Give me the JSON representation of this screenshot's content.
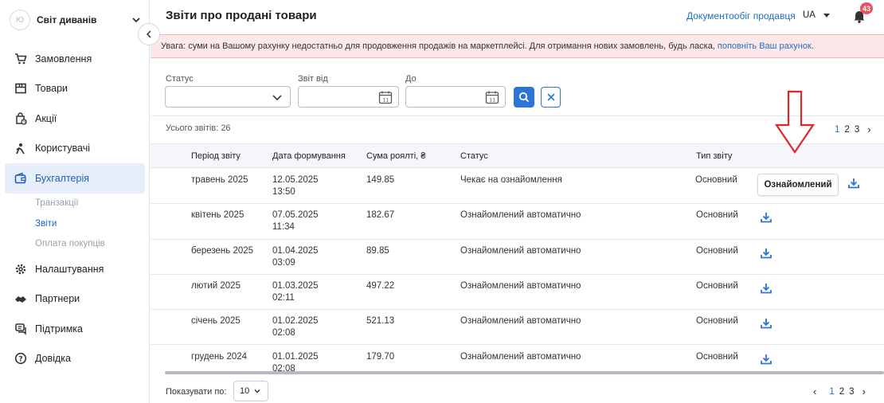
{
  "sidebar": {
    "shop_avatar": "Ю",
    "shop_name": "Світ диванів",
    "items": [
      {
        "label": "Замовлення",
        "icon": "cart-icon"
      },
      {
        "label": "Товари",
        "icon": "box-icon"
      },
      {
        "label": "Акції",
        "icon": "promo-bag-icon"
      },
      {
        "label": "Користувачі",
        "icon": "users-icon"
      },
      {
        "label": "Бухгалтерія",
        "icon": "wallet-icon",
        "active": true
      },
      {
        "label": "Налаштування",
        "icon": "gear-icon"
      },
      {
        "label": "Партнери",
        "icon": "handshake-icon"
      },
      {
        "label": "Підтримка",
        "icon": "support-chat-icon"
      },
      {
        "label": "Довідка",
        "icon": "help-icon"
      }
    ],
    "subitems": [
      {
        "label": "Транзакції"
      },
      {
        "label": "Звіти",
        "current": true
      },
      {
        "label": "Оплата покупців"
      }
    ]
  },
  "header": {
    "title": "Звіти про продані товари",
    "doc_link": "Документообіг продавця",
    "lang": "UA",
    "notifications": "43"
  },
  "alert": {
    "text": "Увага: суми на Вашому рахунку недостатньо для продовження продажів на маркетплейсі. Для отримання нових замовлень, будь ласка,",
    "link": "поповніть Ваш рахунок",
    "end": "."
  },
  "filters": {
    "status_label": "Статус",
    "from_label": "Звіт від",
    "to_label": "До",
    "calendar_day": "11"
  },
  "summary": {
    "total": "Усього звітів: 26"
  },
  "pagination": {
    "pages": [
      "1",
      "2",
      "3"
    ],
    "current": "1"
  },
  "table": {
    "headers": [
      "Період звіту",
      "Дата формування",
      "Сума роялті, ₴",
      "Статус",
      "Тип звіту"
    ],
    "action_label": "Ознайомлений",
    "rows": [
      {
        "period": "травень 2025",
        "date": "12.05.2025",
        "time": "13:50",
        "sum": "149.85",
        "status": "Чекає на ознайомлення",
        "type": "Основний",
        "action": true
      },
      {
        "period": "квітень 2025",
        "date": "07.05.2025",
        "time": "11:34",
        "sum": "182.67",
        "status": "Ознайомлений автоматично",
        "type": "Основний"
      },
      {
        "period": "березень 2025",
        "date": "01.04.2025",
        "time": "03:09",
        "sum": "89.85",
        "status": "Ознайомлений автоматично",
        "type": "Основний"
      },
      {
        "period": "лютий 2025",
        "date": "01.03.2025",
        "time": "02:11",
        "sum": "497.22",
        "status": "Ознайомлений автоматично",
        "type": "Основний"
      },
      {
        "period": "січень 2025",
        "date": "01.02.2025",
        "time": "02:08",
        "sum": "521.13",
        "status": "Ознайомлений автоматично",
        "type": "Основний"
      },
      {
        "period": "грудень 2024",
        "date": "01.01.2025",
        "time": "02:08",
        "sum": "179.70",
        "status": "Ознайомлений автоматично",
        "type": "Основний"
      }
    ]
  },
  "footer": {
    "show_label": "Показувати по:",
    "per_page": "10"
  },
  "colors": {
    "accent": "#2d74da",
    "active_bg": "#e7eefb",
    "alert_bg": "#fce8e8",
    "badge": "#e8535c",
    "annotation_arrow": "#e0252b"
  }
}
